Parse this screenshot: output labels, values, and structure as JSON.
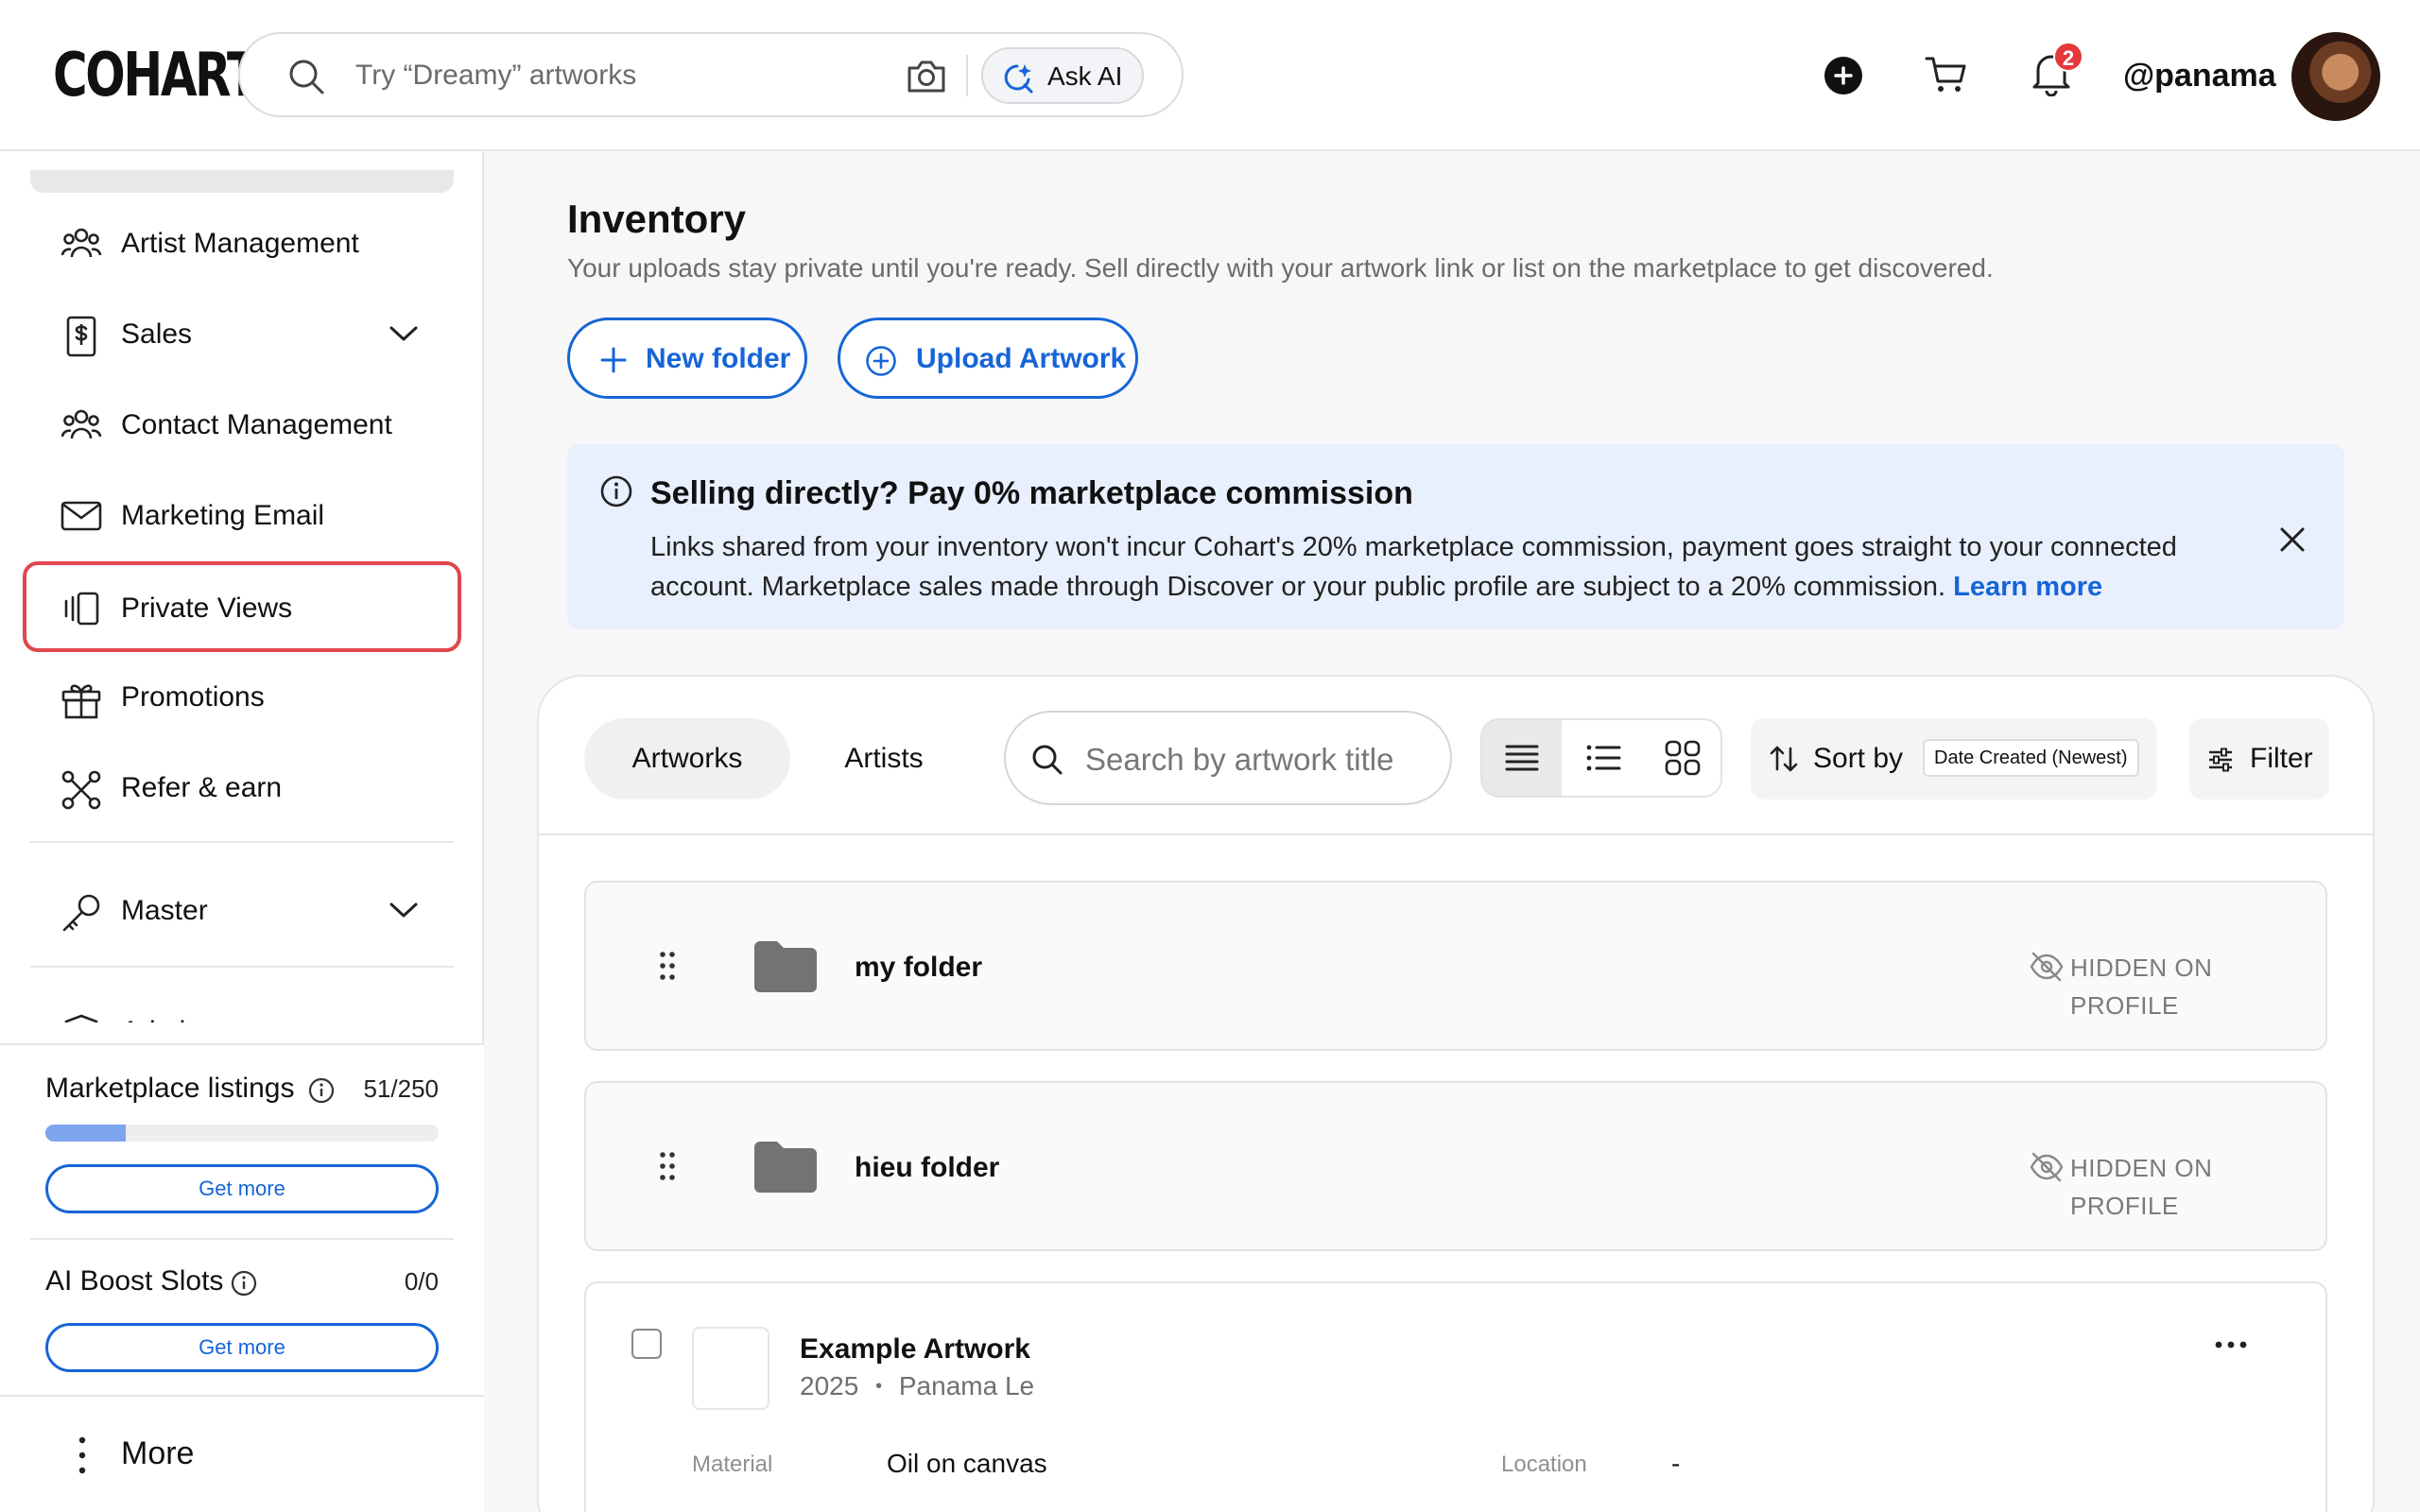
{
  "header": {
    "logo": "COHART",
    "search_placeholder": "Try “Dreamy” artworks",
    "ask_ai_label": "Ask AI",
    "notification_count": "2",
    "username": "@panama"
  },
  "sidebar": {
    "items": [
      {
        "label": "Artist Management",
        "icon": "people-icon"
      },
      {
        "label": "Sales",
        "icon": "dollar-doc-icon"
      },
      {
        "label": "Contact Management",
        "icon": "people-icon"
      },
      {
        "label": "Marketing Email",
        "icon": "mail-icon"
      },
      {
        "label": "Private Views",
        "icon": "private-views-icon",
        "active": true
      },
      {
        "label": "Promotions",
        "icon": "gift-icon"
      },
      {
        "label": "Refer & earn",
        "icon": "share-icon"
      },
      {
        "label": "Master",
        "icon": "key-icon"
      },
      {
        "label": "Admin",
        "icon": "shield-icon"
      }
    ],
    "marketplace": {
      "title": "Marketplace listings",
      "count": "51/250",
      "progress": 0.204,
      "button": "Get more"
    },
    "ai_boost": {
      "title": "AI Boost Slots",
      "count": "0/0",
      "button": "Get more"
    },
    "more_label": "More"
  },
  "main": {
    "title": "Inventory",
    "subtitle": "Your uploads stay private until you're ready. Sell directly with your artwork link or list on the marketplace to get discovered.",
    "new_folder_label": "New folder",
    "upload_label": "Upload Artwork",
    "banner": {
      "title": "Selling directly? Pay 0% marketplace commission",
      "body": "Links shared from your inventory won't incur Cohart's 20% marketplace commission, payment goes straight to your connected account. Marketplace sales made through Discover or your public profile are subject to a 20% commission.",
      "link": "Learn more"
    },
    "tabs": [
      "Artworks",
      "Artists"
    ],
    "search_placeholder": "Search by artwork title",
    "sort_label": "Sort by",
    "sort_value": "Date Created (Newest)",
    "filter_label": "Filter",
    "folders": [
      {
        "name": "my folder",
        "status": "HIDDEN ON PROFILE"
      },
      {
        "name": "hieu folder",
        "status": "HIDDEN ON PROFILE"
      }
    ],
    "artwork": {
      "title": "Example Artwork",
      "year": "2025",
      "separator": "•",
      "artist": "Panama Le",
      "material_label": "Material",
      "material_value": "Oil on canvas",
      "location_label": "Location",
      "location_value": "-"
    }
  },
  "colors": {
    "accent": "#1665d8",
    "active_outline": "#e0464d",
    "banner_bg": "#e8effd",
    "badge": "#e5383b",
    "progress": "#7ea6ef"
  }
}
